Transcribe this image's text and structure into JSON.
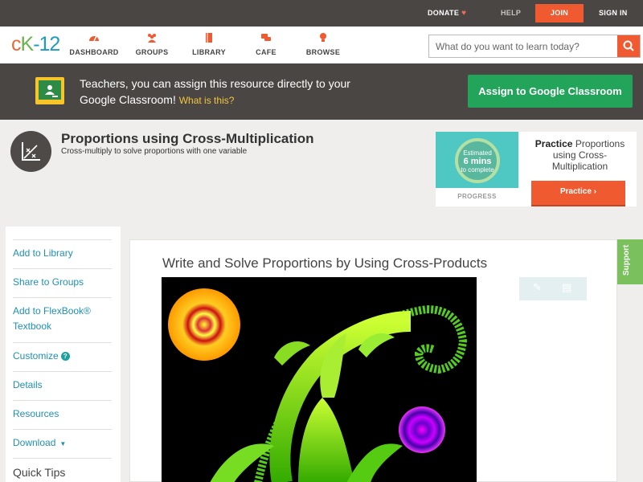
{
  "topbar": {
    "donate": "DONATE",
    "help": "HELP",
    "join": "JOIN",
    "signin": "SIGN IN"
  },
  "logo": {
    "c": "c",
    "k": "K",
    "n": "-12"
  },
  "nav": {
    "items": [
      {
        "label": "DASHBOARD",
        "icon": "dashboard-icon"
      },
      {
        "label": "GROUPS",
        "icon": "groups-icon"
      },
      {
        "label": "LIBRARY",
        "icon": "library-icon"
      },
      {
        "label": "CAFE",
        "icon": "cafe-icon"
      },
      {
        "label": "BROWSE",
        "icon": "browse-icon"
      }
    ]
  },
  "search": {
    "placeholder": "What do you want to learn today?",
    "value": ""
  },
  "banner": {
    "text": "Teachers, you can assign this resource directly to your Google Classroom!",
    "what_link": "What is this?",
    "button": "Assign to Google Classroom"
  },
  "concept": {
    "title": "Proportions using Cross-Multiplication",
    "subtitle": "Cross-multiply to solve proportions with one variable"
  },
  "practice": {
    "estimated": "Estimated",
    "mins": "6 mins",
    "to_complete": "to complete",
    "progress": "PROGRESS",
    "label_bold": "Practice",
    "label_rest": "Proportions using Cross-Multiplication",
    "button": "Practice"
  },
  "sidebar": {
    "items": [
      "Add to Library",
      "Share to Groups",
      "Add to FlexBook® Textbook",
      "Customize",
      "Details",
      "Resources",
      "Download"
    ],
    "customize_badge": "?",
    "quick_tips": "Quick Tips"
  },
  "content": {
    "title": "Write and Solve Proportions by Using Cross-Products"
  },
  "support": "Support",
  "colors": {
    "accent_orange": "#f05a31",
    "header_dark": "#4a4643",
    "link_blue": "#1f90b4",
    "classroom_green": "#22a55a",
    "support_green": "#7ac05c"
  }
}
